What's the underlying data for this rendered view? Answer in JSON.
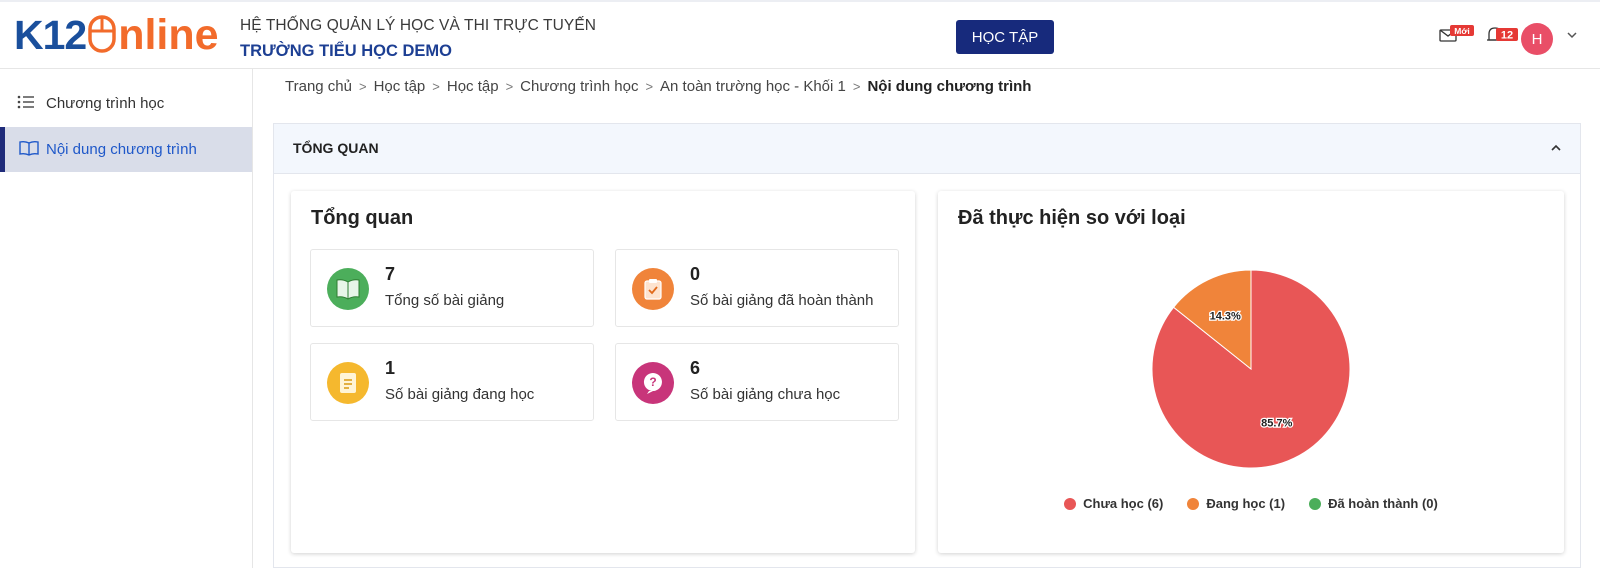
{
  "header": {
    "logo_k12": "K12",
    "logo_online": "nline",
    "system_title": "HỆ THỐNG QUẢN LÝ HỌC VÀ THI TRỰC TUYẾN",
    "school_name": "TRƯỜNG TIỂU HỌC DEMO",
    "main_button": "HỌC TẬP",
    "mail_badge": "Mới",
    "notification_count": "12",
    "avatar_initial": "H"
  },
  "sidebar": {
    "items": [
      {
        "label": "Chương trình học",
        "icon": "list-icon",
        "active": false
      },
      {
        "label": "Nội dung chương trình",
        "icon": "book-open-icon",
        "active": true
      }
    ]
  },
  "breadcrumb": {
    "items": [
      "Trang chủ",
      "Học tập",
      "Học tập",
      "Chương trình học",
      "An toàn trường học - Khối 1"
    ],
    "current": "Nội dung chương trình"
  },
  "panel": {
    "title": "TỔNG QUAN",
    "overview": {
      "title": "Tổng quan",
      "stats": [
        {
          "value": "7",
          "label": "Tổng số bài giảng",
          "icon": "book-icon",
          "color": "#4cae5b"
        },
        {
          "value": "0",
          "label": "Số bài giảng đã hoàn thành",
          "icon": "clipboard-check-icon",
          "color": "#f0843a"
        },
        {
          "value": "1",
          "label": "Số bài giảng đang học",
          "icon": "document-icon",
          "color": "#f5b82e"
        },
        {
          "value": "6",
          "label": "Số bài giảng chưa học",
          "icon": "question-icon",
          "color": "#c8357a"
        }
      ]
    },
    "chart": {
      "title": "Đã thực hiện so với loại"
    }
  },
  "chart_data": {
    "type": "pie",
    "title": "Đã thực hiện so với loại",
    "categories": [
      "Chưa học (6)",
      "Đang học (1)",
      "Đã hoàn thành (0)"
    ],
    "values": [
      6,
      1,
      0
    ],
    "data_labels": [
      "85.7%",
      "14.3%",
      ""
    ],
    "colors": [
      "#e85656",
      "#f0843a",
      "#4cae5b"
    ],
    "legend_position": "bottom"
  },
  "colors": {
    "brand_blue": "#1a4f9c",
    "brand_orange": "#f26b2b",
    "primary_button": "#172a7c",
    "active_link": "#1f58c9",
    "avatar": "#e94e67"
  }
}
